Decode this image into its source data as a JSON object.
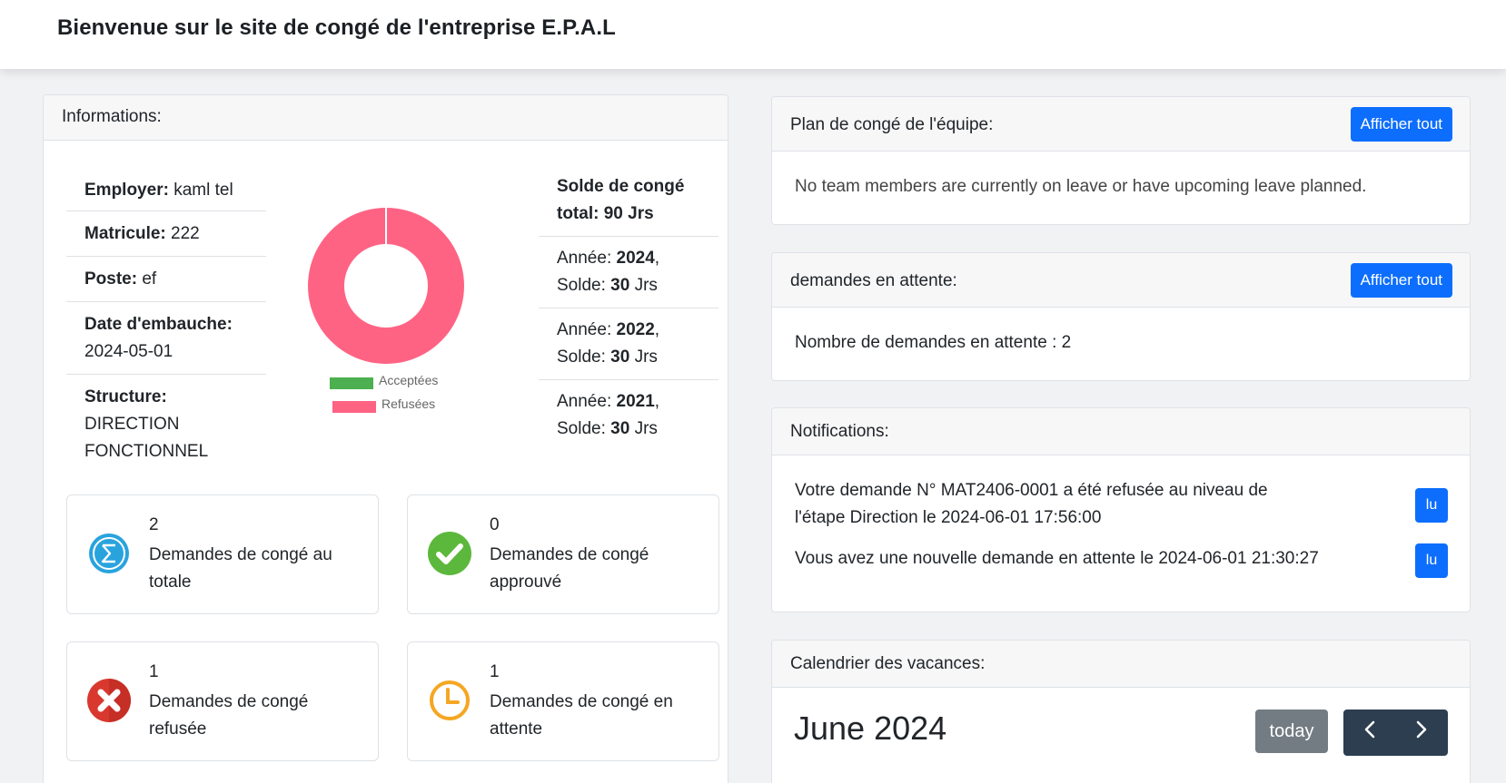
{
  "header": {
    "title": "Bienvenue sur le site de congé de l'entreprise E.P.A.L"
  },
  "info_card": {
    "title": "Informations:",
    "fields": [
      {
        "label": "Employer:",
        "value": " kaml tel"
      },
      {
        "label": "Matricule:",
        "value": " 222"
      },
      {
        "label": "Poste:",
        "value": " ef"
      },
      {
        "label": "Date d'embauche:",
        "value": "2024-05-01"
      },
      {
        "label": "Structure:",
        "value": "DIRECTION FONCTIONNEL"
      }
    ],
    "solde_total": {
      "label": "Solde de congé total:",
      "value": " 90 Jrs"
    },
    "soldes": [
      {
        "annee_label": "Année: ",
        "annee": "2024",
        "sep": ",",
        "solde_label": "Solde: ",
        "solde": "30",
        "unit": " Jrs"
      },
      {
        "annee_label": "Année: ",
        "annee": "2022",
        "sep": ",",
        "solde_label": "Solde: ",
        "solde": "30",
        "unit": " Jrs"
      },
      {
        "annee_label": "Année: ",
        "annee": "2021",
        "sep": ",",
        "solde_label": "Solde: ",
        "solde": "30",
        "unit": " Jrs"
      }
    ],
    "chart": {
      "legend": [
        {
          "name": "Acceptées",
          "color": "#4caf50"
        },
        {
          "name": "Refusées",
          "color": "#ff6384"
        }
      ]
    },
    "stats": [
      {
        "count": "2",
        "label": "Demandes de congé au totale",
        "icon": "sigma-icon",
        "color": "#29a3de"
      },
      {
        "count": "0",
        "label": "Demandes de congé approuvé",
        "icon": "check-circle-icon",
        "color": "#5cb83c"
      },
      {
        "count": "1",
        "label": "Demandes de congé refusée",
        "icon": "x-circle-icon",
        "color": "#d9382e"
      },
      {
        "count": "1",
        "label": "Demandes de congé en attente",
        "icon": "clock-icon",
        "color": "#f5a623"
      }
    ]
  },
  "chart_data": {
    "type": "pie",
    "categories": [
      "Acceptées",
      "Refusées"
    ],
    "values": [
      0,
      1
    ],
    "legend_position": "bottom"
  },
  "team_plan": {
    "title": "Plan de congé de l'équipe:",
    "button": "Afficher tout",
    "message": "No team members are currently on leave or have upcoming leave planned."
  },
  "pending": {
    "title": "demandes en attente:",
    "button": "Afficher tout",
    "message": "Nombre de demandes en attente : 2"
  },
  "notifications": {
    "title": "Notifications:",
    "items": [
      {
        "line1": "Votre demande N° MAT2406-0001 a été refusée au niveau de",
        "line2": "l'étape Direction le 2024-06-01 17:56:00",
        "button": "lu"
      },
      {
        "line1": "Vous avez une nouvelle demande en attente le 2024-06-01 21:30:27",
        "button": "lu"
      }
    ]
  },
  "calendar": {
    "title": "Calendrier des vacances:",
    "month": "June 2024",
    "today": "today",
    "prev": "‹",
    "next": "›"
  }
}
